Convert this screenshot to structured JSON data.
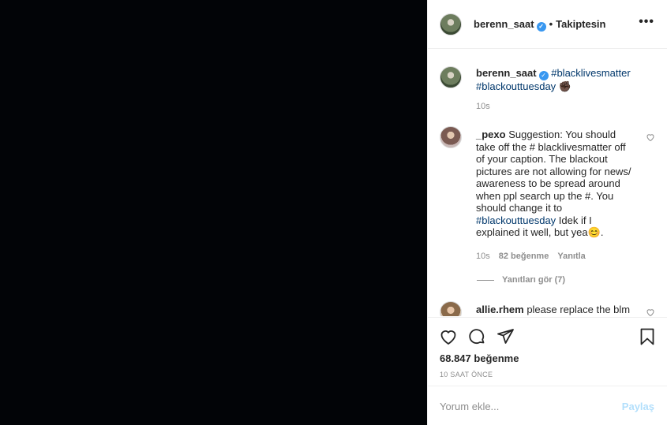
{
  "header": {
    "username": "berenn_saat",
    "separator": "•",
    "follow_status": "Takiptesin",
    "more": "•••"
  },
  "caption": {
    "username": "berenn_saat",
    "tag1": "#blacklivesmatter",
    "tag2": "#blackouttuesday",
    "emoji": "✊🏿",
    "time": "10s"
  },
  "comment1": {
    "username": "_pexo",
    "text_a": " Suggestion: You should take off the # blacklivesmatter off of your caption. The blackout pictures are not allowing for news/ awareness to be spread around when ppl search up the #. You should change it to ",
    "tag": "#blackouttuesday",
    "text_b": " Idek if I explained it well, but yea😊.",
    "time": "10s",
    "likes": "82 beğenme",
    "reply": "Yanıtla",
    "view_replies": "Yanıtları gör (7)"
  },
  "comment2": {
    "username": "allie.rhem",
    "text": " please replace the blm"
  },
  "actions": {
    "likes": "68.847 beğenme",
    "ago": "10 SAAT ÖNCE"
  },
  "add_comment": {
    "placeholder": "Yorum ekle...",
    "post_label": "Paylaş"
  },
  "colors": {
    "media_bg": "#020407",
    "link": "#00376b",
    "verified": "#3897f0",
    "post_disabled": "#b2dffc"
  }
}
